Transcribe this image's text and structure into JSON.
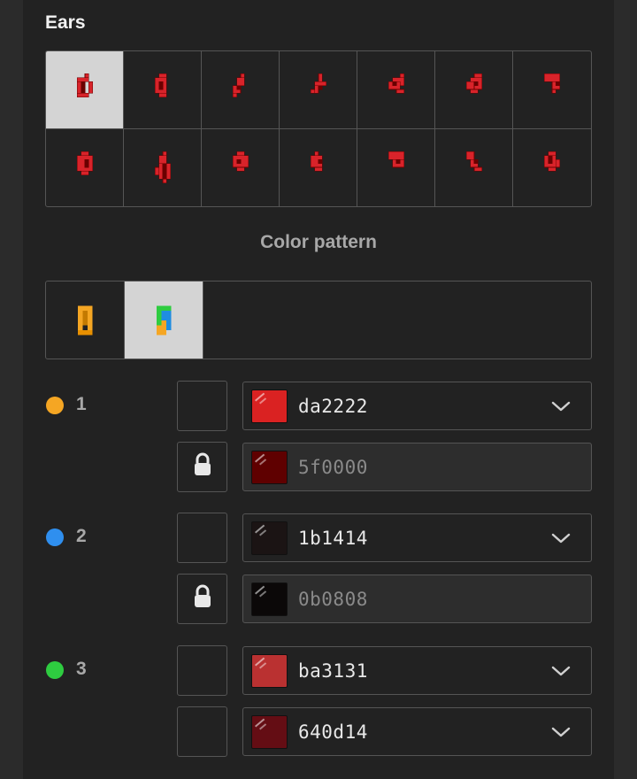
{
  "ears": {
    "title": "Ears",
    "options": [
      {
        "shape": "ear-1",
        "selected": true
      },
      {
        "shape": "ear-2",
        "selected": false
      },
      {
        "shape": "ear-3",
        "selected": false
      },
      {
        "shape": "ear-4",
        "selected": false
      },
      {
        "shape": "ear-5",
        "selected": false
      },
      {
        "shape": "ear-6",
        "selected": false
      },
      {
        "shape": "ear-7",
        "selected": false
      },
      {
        "shape": "ear-8",
        "selected": false
      },
      {
        "shape": "ear-9",
        "selected": false
      },
      {
        "shape": "ear-10",
        "selected": false
      },
      {
        "shape": "ear-11",
        "selected": false
      },
      {
        "shape": "ear-12",
        "selected": false
      },
      {
        "shape": "ear-13",
        "selected": false
      },
      {
        "shape": "ear-14",
        "selected": false
      }
    ],
    "sprite_color": "#d8232a",
    "sprite_dark": "#6a0000"
  },
  "color_pattern": {
    "title": "Color pattern",
    "options": [
      {
        "shape": "single-color",
        "selected": false
      },
      {
        "shape": "multi-color",
        "selected": true
      }
    ]
  },
  "slots": [
    {
      "number": "1",
      "dot_color": "#f5a623",
      "primary": {
        "hex": "da2222",
        "color": "#da2222",
        "locked": false
      },
      "secondary": {
        "hex": "5f0000",
        "color": "#5f0000",
        "locked": true
      }
    },
    {
      "number": "2",
      "dot_color": "#2f8fef",
      "primary": {
        "hex": "1b1414",
        "color": "#1b1414",
        "locked": false
      },
      "secondary": {
        "hex": "0b0808",
        "color": "#0b0808",
        "locked": true
      }
    },
    {
      "number": "3",
      "dot_color": "#2ecc40",
      "primary": {
        "hex": "ba3131",
        "color": "#ba3131",
        "locked": false
      },
      "secondary": {
        "hex": "640d14",
        "color": "#640d14",
        "locked": false
      }
    }
  ]
}
